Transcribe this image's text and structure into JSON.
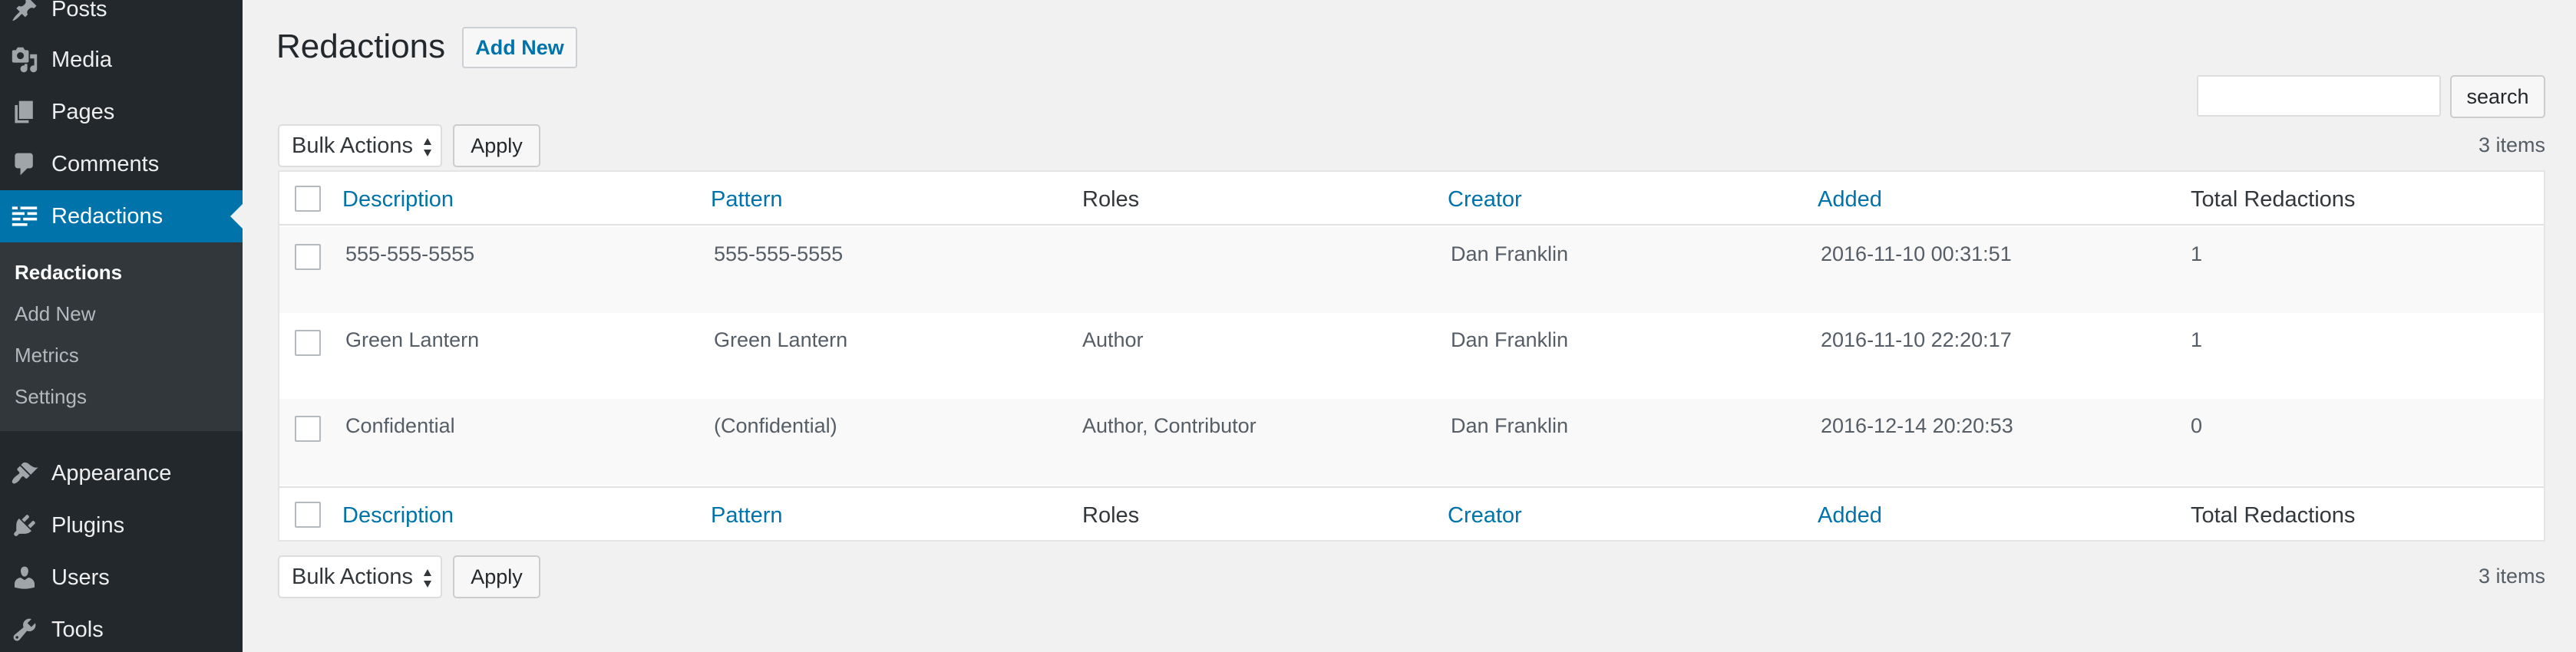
{
  "sidebar": {
    "items": [
      {
        "label": "Posts",
        "icon": "pin-icon"
      },
      {
        "label": "Media",
        "icon": "media-icon"
      },
      {
        "label": "Pages",
        "icon": "pages-icon"
      },
      {
        "label": "Comments",
        "icon": "comment-icon"
      },
      {
        "label": "Redactions",
        "icon": "redactions-icon"
      },
      {
        "label": "Appearance",
        "icon": "paintbrush-icon"
      },
      {
        "label": "Plugins",
        "icon": "plugin-icon"
      },
      {
        "label": "Users",
        "icon": "user-icon"
      },
      {
        "label": "Tools",
        "icon": "wrench-icon"
      }
    ],
    "submenu": [
      "Redactions",
      "Add New",
      "Metrics",
      "Settings"
    ]
  },
  "header": {
    "title": "Redactions",
    "add_new": "Add New"
  },
  "search": {
    "value": "",
    "button": "search"
  },
  "toolbar": {
    "bulk_actions": "Bulk Actions",
    "apply": "Apply",
    "count": "3 items"
  },
  "table": {
    "columns": [
      "Description",
      "Pattern",
      "Roles",
      "Creator",
      "Added",
      "Total Redactions"
    ],
    "rows": [
      {
        "description": "555-555-5555",
        "pattern": "555-555-5555",
        "roles": "",
        "creator": "Dan Franklin",
        "added": "2016-11-10 00:31:51",
        "total": "1"
      },
      {
        "description": "Green Lantern",
        "pattern": "Green Lantern",
        "roles": "Author",
        "creator": "Dan Franklin",
        "added": "2016-11-10 22:20:17",
        "total": "1"
      },
      {
        "description": "Confidential",
        "pattern": "(Confidential)",
        "roles": "Author, Contributor",
        "creator": "Dan Franklin",
        "added": "2016-12-14 20:20:53",
        "total": "0"
      }
    ]
  },
  "colors": {
    "sidebar_bg": "#23282d",
    "submenu_bg": "#32373c",
    "accent": "#0073aa",
    "page_bg": "#f1f1f1"
  }
}
